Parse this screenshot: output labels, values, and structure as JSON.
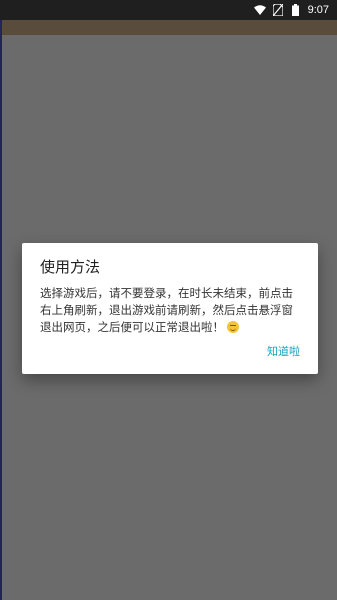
{
  "status_bar": {
    "time": "9:07",
    "icons": [
      "wifi-icon",
      "no-sim-icon",
      "battery-icon"
    ]
  },
  "dialog": {
    "title": "使用方法",
    "message": "选择游戏后，请不要登录，在时长未结束，前点击右上角刷新，退出游戏前请刷新，然后点击悬浮窗退出网页，之后便可以正常退出啦！",
    "emoji": "smiling-face-icon",
    "button_label": "知道啦"
  },
  "colors": {
    "overlay": "#6b6b6b",
    "status_bar": "#1f1f1f",
    "accent": "#1aa1c4"
  }
}
